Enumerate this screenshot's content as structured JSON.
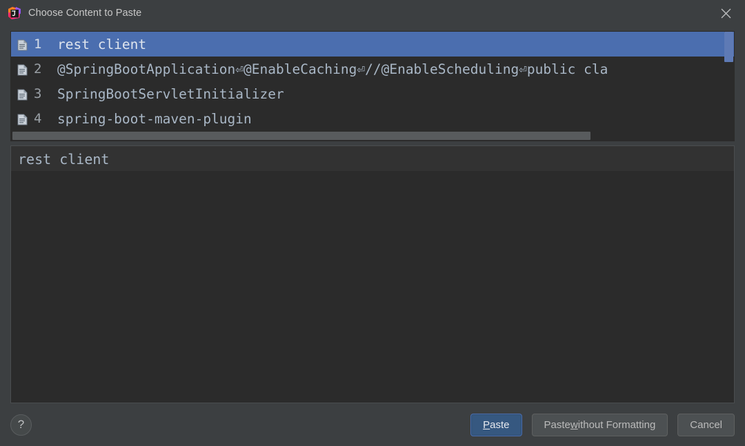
{
  "window": {
    "title": "Choose Content to Paste",
    "app_icon": "intellij-idea-icon",
    "close_icon": "close-icon"
  },
  "list": {
    "name": "clipboard-history-list",
    "items": [
      {
        "index": "1",
        "icon": "document-icon",
        "text": "rest client",
        "selected": true
      },
      {
        "index": "2",
        "icon": "document-icon",
        "text": "@SpringBootApplication⏎@EnableCaching⏎//@EnableScheduling⏎public cla",
        "selected": false
      },
      {
        "index": "3",
        "icon": "document-icon",
        "text": "SpringBootServletInitializer",
        "selected": false
      },
      {
        "index": "4",
        "icon": "document-icon",
        "text": "spring-boot-maven-plugin",
        "selected": false
      }
    ],
    "scrollbars": {
      "horizontal": "horizontal-scrollbar",
      "vertical": "vertical-scrollbar"
    }
  },
  "preview": {
    "name": "paste-preview",
    "content": "rest client"
  },
  "footer": {
    "help_label": "?",
    "paste_label": "Paste",
    "paste_mnemonic": "P",
    "paste_rest": "aste",
    "paste_plain_prefix": "Paste ",
    "paste_plain_mnemonic": "w",
    "paste_plain_rest": "ithout Formatting",
    "cancel_label": "Cancel"
  },
  "colors": {
    "dialog_bg": "#3c3f41",
    "editor_bg": "#2b2b2b",
    "selection_blue": "#4b6eaf",
    "default_button_bg": "#365880",
    "text_fg": "#a9b7c6"
  }
}
